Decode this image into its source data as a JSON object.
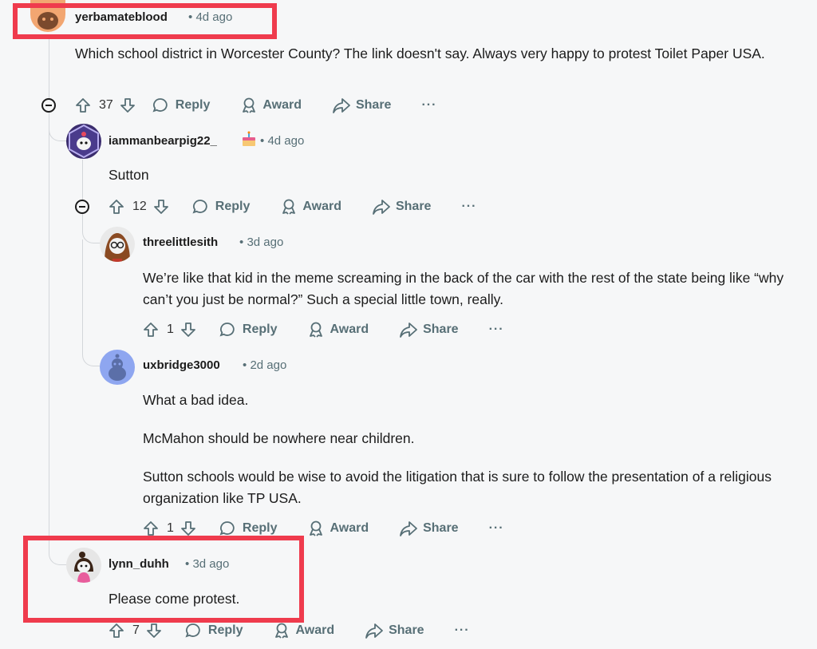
{
  "highlight_color": "#ef3b4d",
  "comments": [
    {
      "username": "yerbamateblood",
      "flair_icon": "",
      "time": "4d ago",
      "body": [
        "Which school district in Worcester County? The link doesn't say. Always very happy to protest Toilet Paper USA."
      ],
      "votes": "37",
      "actions": {
        "reply": "Reply",
        "award": "Award",
        "share": "Share",
        "more": "···"
      }
    },
    {
      "username": "iammanbearpig22_",
      "flair_icon": "cake-icon",
      "time": "4d ago",
      "body": [
        "Sutton"
      ],
      "votes": "12",
      "actions": {
        "reply": "Reply",
        "award": "Award",
        "share": "Share",
        "more": "···"
      }
    },
    {
      "username": "threelittlesith",
      "time": "3d ago",
      "body": [
        "We’re like that kid in the meme screaming in the back of the car with the rest of the state being like “why can’t you just be normal?” Such a special little town, really."
      ],
      "votes": "1",
      "actions": {
        "reply": "Reply",
        "award": "Award",
        "share": "Share",
        "more": "···"
      }
    },
    {
      "username": "uxbridge3000",
      "time": "2d ago",
      "body": [
        "What a bad idea.",
        "McMahon should be nowhere near children.",
        "Sutton schools would be wise to avoid the litigation that is sure to follow the presentation of a religious organization like TP USA."
      ],
      "votes": "1",
      "actions": {
        "reply": "Reply",
        "award": "Award",
        "share": "Share",
        "more": "···"
      }
    },
    {
      "username": "lynn_duhh",
      "time": "3d ago",
      "body": [
        "Please come protest."
      ],
      "votes": "7",
      "actions": {
        "reply": "Reply",
        "award": "Award",
        "share": "Share",
        "more": "···"
      }
    }
  ],
  "separator": "•"
}
